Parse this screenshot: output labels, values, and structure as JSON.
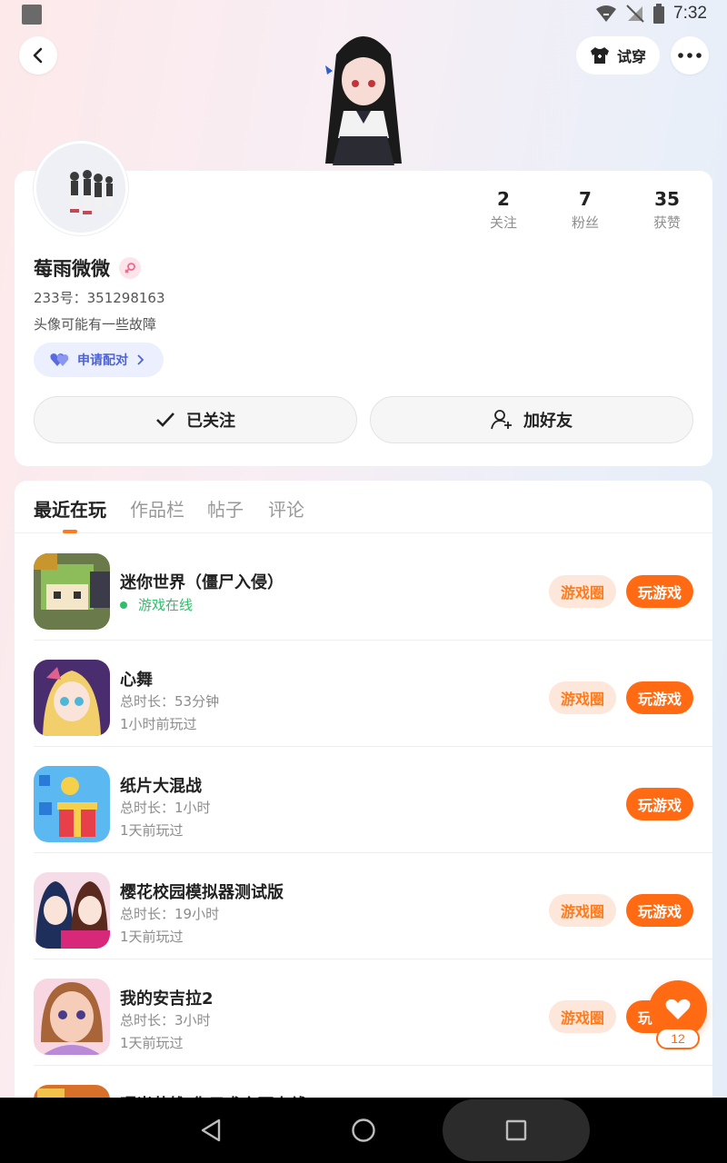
{
  "status_bar": {
    "time": "7:32"
  },
  "header": {
    "tryon_label": "试穿"
  },
  "profile": {
    "stats": [
      {
        "value": "2",
        "label": "关注"
      },
      {
        "value": "7",
        "label": "粉丝"
      },
      {
        "value": "35",
        "label": "获赞"
      }
    ],
    "username": "莓雨微微",
    "uid": "233号：351298163",
    "bio": "头像可能有一些故障",
    "pair_label": "申请配对",
    "followed_label": "已关注",
    "add_friend_label": "加好友"
  },
  "tabs": [
    {
      "label": "最近在玩",
      "active": true
    },
    {
      "label": "作品栏",
      "active": false
    },
    {
      "label": "帖子",
      "active": false
    },
    {
      "label": "评论",
      "active": false
    }
  ],
  "games": [
    {
      "name": "迷你世界（僵尸入侵）",
      "status": "游戏在线",
      "circle_label": "游戏圈",
      "play_label": "玩游戏"
    },
    {
      "name": "心舞",
      "duration": "总时长：53分钟",
      "last_played": "1小时前玩过",
      "circle_label": "游戏圈",
      "play_label": "玩游戏"
    },
    {
      "name": "纸片大混战",
      "duration": "总时长：1小时",
      "last_played": "1天前玩过",
      "play_label": "玩游戏"
    },
    {
      "name": "樱花校园模拟器测试版",
      "duration": "总时长：19小时",
      "last_played": "1天前玩过",
      "circle_label": "游戏圈",
      "play_label": "玩游戏"
    },
    {
      "name": "我的安吉拉2",
      "duration": "总时长：3小时",
      "last_played": "1天前玩过",
      "circle_label": "游戏圈",
      "play_label": "玩游戏"
    },
    {
      "name": "曙光英雄-你只求之不上线"
    }
  ],
  "like": {
    "count": "12"
  },
  "colors": {
    "accent": "#ff6a13",
    "online": "#2fbf6a",
    "pair": "#4d64d6"
  }
}
